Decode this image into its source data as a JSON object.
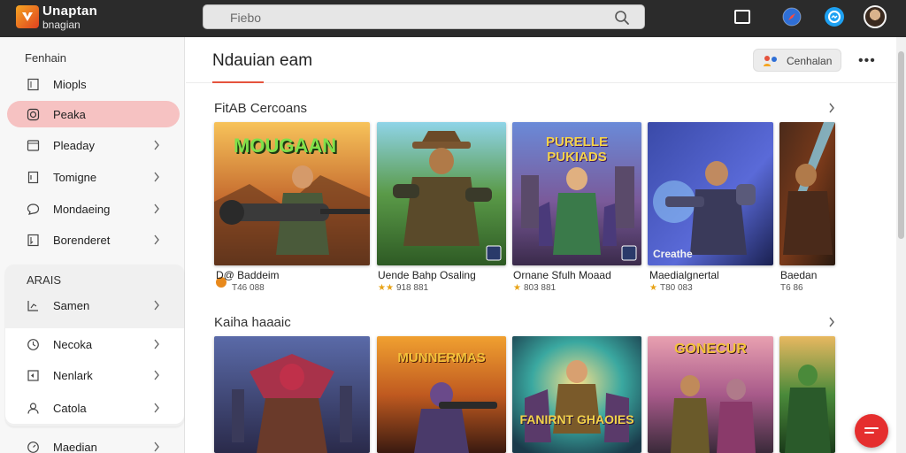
{
  "app": {
    "title": "Unaptan",
    "subtitle": "bnagian",
    "colors": {
      "topbar": "#2b2b2b",
      "accent": "#e5533d",
      "active_item": "#f6c2c2",
      "fab": "#e52e2e"
    }
  },
  "search": {
    "placeholder": "Fiebo"
  },
  "top_icons": [
    "window-icon",
    "compass-icon",
    "messenger-icon",
    "avatar"
  ],
  "sidebar": {
    "heading": "Fenhain",
    "items": [
      {
        "label": "Miopls",
        "icon": "book-icon",
        "chevron": false,
        "active": false
      },
      {
        "label": "Peaka",
        "icon": "ring-icon",
        "chevron": false,
        "active": true
      },
      {
        "label": "Pleaday",
        "icon": "calendar-icon",
        "chevron": true,
        "active": false
      },
      {
        "label": "Tomigne",
        "icon": "page-icon",
        "chevron": true,
        "active": false
      },
      {
        "label": "Mondaeing",
        "icon": "chat-icon",
        "chevron": true,
        "active": false
      },
      {
        "label": "Borenderet",
        "icon": "bookmark-icon",
        "chevron": true,
        "active": false
      }
    ],
    "group": {
      "heading": "ARAIS",
      "items": [
        {
          "label": "Samen",
          "icon": "chart-icon",
          "chevron": true
        },
        {
          "label": "Necoka",
          "icon": "clock-icon",
          "chevron": true
        },
        {
          "label": "Nenlark",
          "icon": "flag-icon",
          "chevron": true
        }
      ]
    },
    "bottom_items": [
      {
        "label": "Catola",
        "icon": "person-icon",
        "chevron": true
      },
      {
        "label": "Maedian",
        "icon": "gauge-icon",
        "chevron": true
      }
    ]
  },
  "header": {
    "title": "Ndauian eam",
    "contact_label": "Cenhalan",
    "more_label": "•••"
  },
  "sections": [
    {
      "title": "FitAB Cercoans",
      "cards": [
        {
          "art_title": "MOUGAAN",
          "name": "D@ Baddeim",
          "meta": "T46 088",
          "badge": "orange-dot"
        },
        {
          "art_title": "",
          "name": "Uende Bahp Osaling",
          "meta": "918 881",
          "badge": "stars"
        },
        {
          "art_title": "PURELLE PUKIADS",
          "name": "Ornane Sfulh Moaad",
          "meta": "803 881",
          "badge": "stars"
        },
        {
          "art_title": "",
          "art_caption": "Creathe",
          "name": "Maedialgnertal",
          "meta": "T80 083",
          "badge": "stars"
        },
        {
          "art_title": "",
          "name": "Baedan",
          "meta": "T6 86",
          "badge": "none"
        }
      ]
    },
    {
      "title": "Kaiha haaaic",
      "cards": [
        {
          "art_title": "",
          "name": "",
          "meta": "",
          "badge": "none"
        },
        {
          "art_title": "MUNNERMAS",
          "name": "",
          "meta": "",
          "badge": "none"
        },
        {
          "art_title": "FANIRNT GHAOIES",
          "name": "",
          "meta": "",
          "badge": "none"
        },
        {
          "art_title": "GONECUR",
          "name": "",
          "meta": "",
          "badge": "none"
        },
        {
          "art_title": "",
          "name": "",
          "meta": "",
          "badge": "none"
        }
      ]
    }
  ]
}
